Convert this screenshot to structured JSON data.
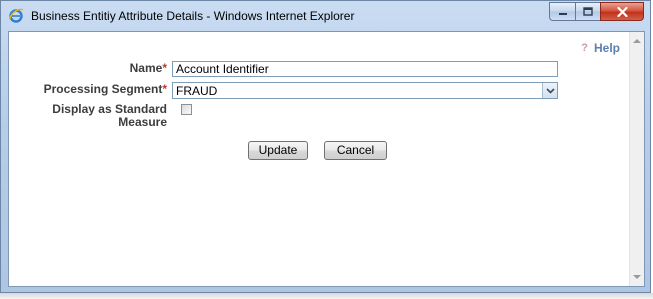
{
  "window": {
    "title": "Business Entitiy Attribute Details - Windows Internet Explorer"
  },
  "help": {
    "icon_glyph": "?",
    "label": "Help"
  },
  "form": {
    "name_label": "Name",
    "segment_label": "Processing Segment",
    "required_marker": "*",
    "measure_label_line1": "Display as Standard",
    "measure_label_line2": "Measure",
    "name_value": "Account Identifier",
    "segment_value": "FRAUD",
    "display_as_standard_measure_checked": false
  },
  "buttons": {
    "update_label": "Update",
    "cancel_label": "Cancel"
  },
  "icons": {
    "browser": "internet-explorer-icon",
    "minimize": "minimize-icon",
    "maximize": "maximize-icon",
    "close": "close-icon",
    "dropdown": "chevron-down-icon"
  },
  "colors": {
    "required": "#c0392b",
    "help_link": "#5b7fae",
    "close_button": "#c2321a"
  }
}
